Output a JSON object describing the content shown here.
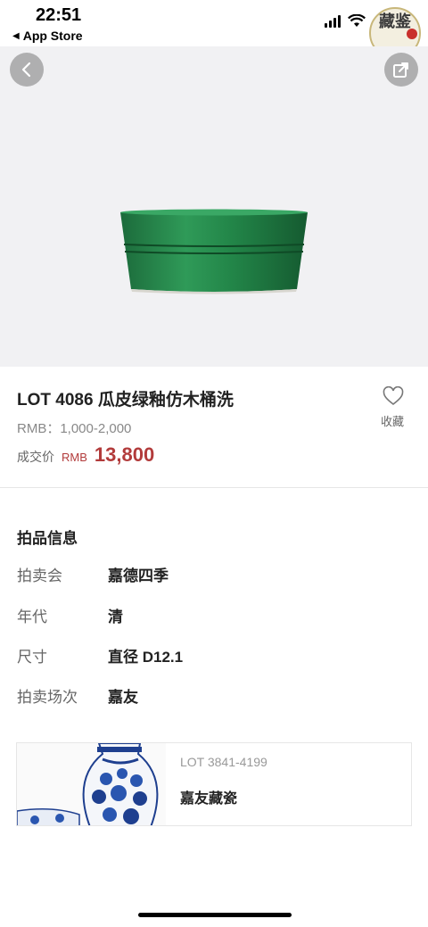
{
  "status_bar": {
    "time": "22:51",
    "back_app": "App Store",
    "seal_text": "藏鉴"
  },
  "hero": {
    "back_icon": "chevron-left-icon",
    "share_icon": "share-icon",
    "image": "green-glazed-bowl"
  },
  "lot": {
    "title": "LOT 4086 瓜皮绿釉仿木桶洗",
    "estimate": "RMB：1,000-2,000",
    "deal_label": "成交价",
    "deal_currency": "RMB",
    "deal_price": "13,800",
    "fav_label": "收藏",
    "price_color": "#b23b3b"
  },
  "info": {
    "section_title": "拍品信息",
    "rows": [
      {
        "label": "拍卖会",
        "value": "嘉德四季"
      },
      {
        "label": "年代",
        "value": "清"
      },
      {
        "label": "尺寸",
        "value": "直径 D12.1"
      },
      {
        "label": "拍卖场次",
        "value": "嘉友"
      }
    ]
  },
  "related": {
    "lot_range": "LOT 3841-4199",
    "name": "嘉友藏瓷"
  }
}
